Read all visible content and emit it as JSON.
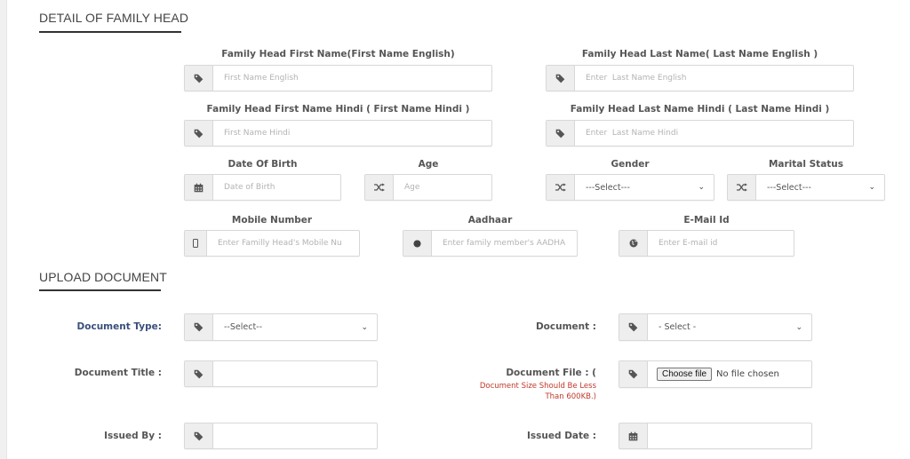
{
  "sections": {
    "family_head_title": "DETAIL OF FAMILY HEAD",
    "upload_title": "UPLOAD DOCUMENT"
  },
  "family_head": {
    "first_name_en": {
      "label": "Family Head First Name(First Name English)",
      "placeholder": "First Name English",
      "icon": "tag-icon"
    },
    "last_name_en": {
      "label": "Family Head Last Name( Last Name English )",
      "placeholder": "Enter  Last Name English",
      "icon": "tag-icon"
    },
    "first_name_hi": {
      "label": "Family Head First Name Hindi ( First Name Hindi )",
      "placeholder": "First Name Hindi",
      "icon": "tag-icon"
    },
    "last_name_hi": {
      "label": "Family Head Last Name Hindi ( Last Name Hindi )",
      "placeholder": "Enter  Last Name Hindi",
      "icon": "tag-icon"
    },
    "dob": {
      "label": "Date Of Birth",
      "placeholder": "Date of Birth",
      "icon": "calendar-icon"
    },
    "age": {
      "label": "Age",
      "placeholder": "Age",
      "icon": "shuffle-icon"
    },
    "gender": {
      "label": "Gender",
      "selected": "---Select---",
      "icon": "shuffle-icon"
    },
    "marital_status": {
      "label": "Marital Status",
      "selected": "---Select---",
      "icon": "shuffle-icon"
    },
    "mobile": {
      "label": "Mobile Number",
      "placeholder": "Enter Familly Head's Mobile Nu",
      "icon": "mobile-icon"
    },
    "aadhaar": {
      "label": "Aadhaar",
      "placeholder": "Enter family member's AADHA",
      "icon": "circle-icon"
    },
    "email": {
      "label": "E-Mail Id",
      "placeholder": "Enter E-mail id",
      "icon": "globe-icon"
    }
  },
  "upload": {
    "document_type": {
      "label": "Document Type:",
      "selected": "--Select--"
    },
    "document": {
      "label": "Document :",
      "selected": "- Select -"
    },
    "document_title": {
      "label": "Document Title :",
      "value": ""
    },
    "document_file": {
      "label": "Document File : (",
      "note_line1": "Document Size Should Be Less",
      "note_line2": "Than 600KB.)",
      "button": "Choose file",
      "status": "No file chosen"
    },
    "issued_by": {
      "label": "Issued By :",
      "value": ""
    },
    "issued_date": {
      "label": "Issued Date :",
      "value": ""
    }
  },
  "colors": {
    "label_blue": "#3b4f7c",
    "note_red": "#c0392b",
    "addon_bg": "#eeeeee"
  }
}
